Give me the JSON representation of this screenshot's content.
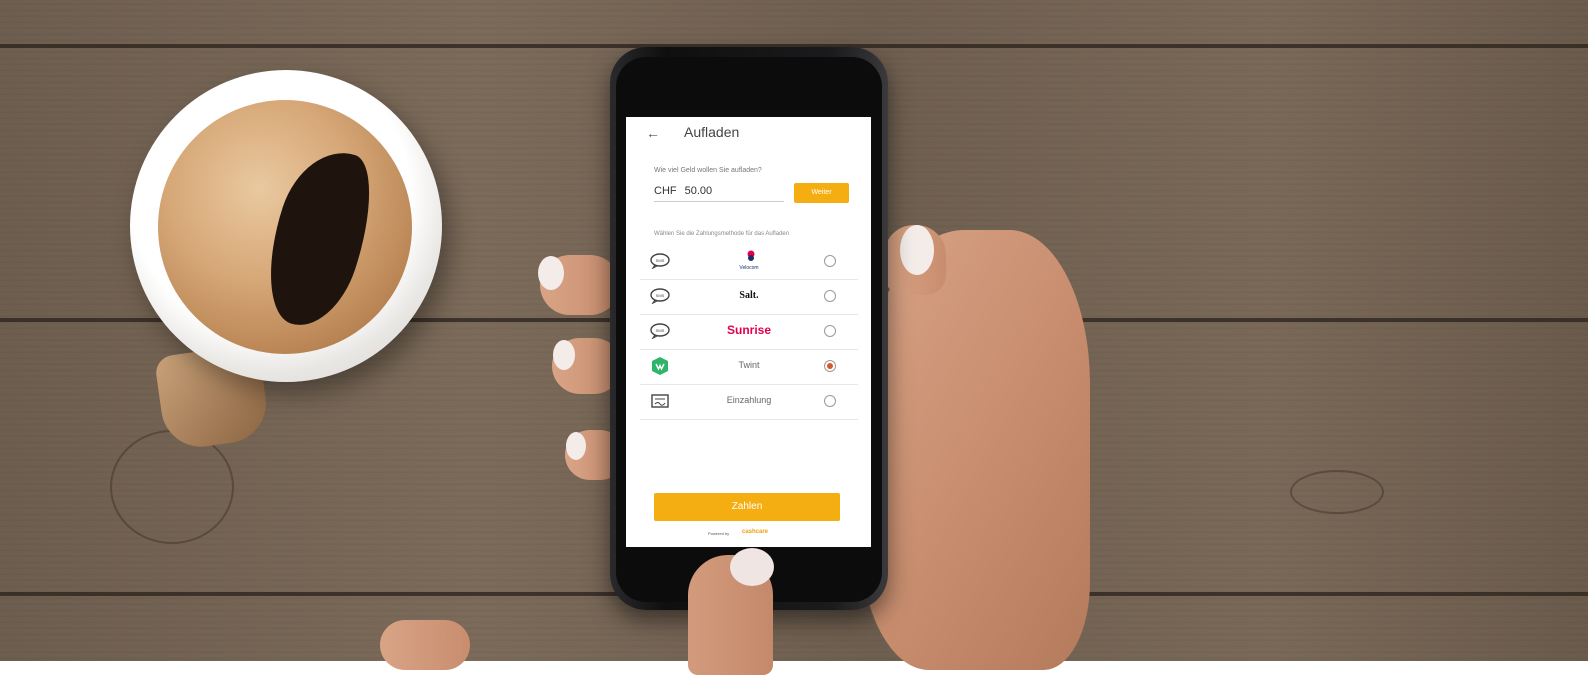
{
  "header": {
    "back_icon": "arrow-left-icon",
    "title": "Aufladen"
  },
  "amount": {
    "prompt": "Wie viel Geld wollen Sie aufladen?",
    "currency": "CHF",
    "value": "50.00",
    "next_label": "Weiter"
  },
  "methods": {
    "prompt": "Wählen Sie die Zahlungsmethode für das Aufladen",
    "items": [
      {
        "icon": "sms-bubble-icon",
        "label": "Velocom",
        "selected": false
      },
      {
        "icon": "sms-bubble-icon",
        "label": "Salt.",
        "selected": false
      },
      {
        "icon": "sms-bubble-icon",
        "label": "Sunrise",
        "selected": false
      },
      {
        "icon": "twint-icon",
        "label": "Twint",
        "selected": true
      },
      {
        "icon": "deposit-slip-icon",
        "label": "Einzahlung",
        "selected": false
      }
    ]
  },
  "footer": {
    "pay_label": "Zahlen",
    "powered_by": "Powered by",
    "powered_brand": "cashcare"
  },
  "colors": {
    "accent": "#f4ae11",
    "radio_selected": "#d35a2d",
    "sunrise": "#e3004f",
    "twint": "#2fb56a"
  }
}
